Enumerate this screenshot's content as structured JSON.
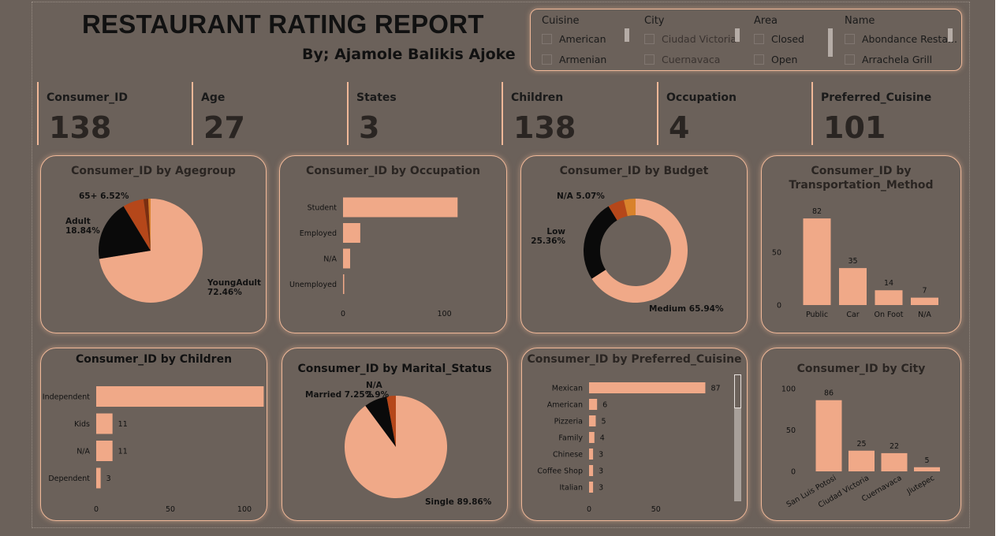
{
  "header": {
    "title": "RESTAURANT RATING REPORT",
    "subtitle": "By; Ajamole Balikis Ajoke"
  },
  "slicers": [
    {
      "label": "Cuisine",
      "items": [
        "American",
        "Armenian"
      ]
    },
    {
      "label": "City",
      "items": [
        "Ciudad Victoria",
        "Cuernavaca"
      ]
    },
    {
      "label": "Area",
      "items": [
        "Closed",
        "Open"
      ]
    },
    {
      "label": "Name",
      "items": [
        "Abondance Resta...",
        "Arrachela Grill"
      ]
    }
  ],
  "kpis": [
    {
      "label": "Consumer_ID",
      "value": "138"
    },
    {
      "label": "Age",
      "value": "27"
    },
    {
      "label": "States",
      "value": "3"
    },
    {
      "label": "Children",
      "value": "138"
    },
    {
      "label": "Occupation",
      "value": "4"
    },
    {
      "label": "Preferred_Cuisine",
      "value": "101"
    }
  ],
  "colors": {
    "background": "#6b615a",
    "accent": "#f0a988",
    "border": "#f0b898",
    "black": "#0a0a0a",
    "rust": "#b5471a",
    "orange": "#d9822b"
  },
  "chart_data": [
    {
      "id": "agegroup",
      "type": "pie",
      "title": "Consumer_ID by Agegroup",
      "slices": [
        {
          "name": "YoungAdult",
          "value": 72.46,
          "label": "YoungAdult\n72.46%"
        },
        {
          "name": "Adult",
          "value": 18.84,
          "label": "Adult\n18.84%"
        },
        {
          "name": "65+",
          "value": 6.52,
          "label": "65+ 6.52%"
        },
        {
          "name": "",
          "value": 1.45,
          "label": ""
        },
        {
          "name": "",
          "value": 0.73,
          "label": ""
        }
      ]
    },
    {
      "id": "occupation",
      "type": "bar",
      "orientation": "horizontal",
      "title": "Consumer_ID by Occupation",
      "categories": [
        "Student",
        "Employed",
        "N/A",
        "Unemployed"
      ],
      "values": [
        113,
        17,
        7,
        1
      ],
      "xticks": [
        0,
        100
      ],
      "xlim": [
        0,
        140
      ]
    },
    {
      "id": "budget",
      "type": "pie",
      "donut": true,
      "title": "Consumer_ID by Budget",
      "slices": [
        {
          "name": "Medium",
          "value": 65.94,
          "label": "Medium 65.94%"
        },
        {
          "name": "Low",
          "value": 25.36,
          "label": "Low\n25.36%"
        },
        {
          "name": "N/A",
          "value": 5.07,
          "label": "N/A 5.07%"
        },
        {
          "name": "",
          "value": 3.63,
          "label": ""
        }
      ]
    },
    {
      "id": "transport",
      "type": "bar",
      "orientation": "vertical",
      "title": "Consumer_ID by Transportation_Method",
      "title_lines": [
        "Consumer_ID by",
        "Transportation_Method"
      ],
      "categories": [
        "Public",
        "Car",
        "On Foot",
        "N/A"
      ],
      "values": [
        82,
        35,
        14,
        7
      ],
      "yticks": [
        0,
        50
      ],
      "ylim": [
        0,
        100
      ]
    },
    {
      "id": "children",
      "type": "bar",
      "orientation": "horizontal",
      "title": "Consumer_ID by Children",
      "categories": [
        "Independent",
        "Kids",
        "N/A",
        "Dependent"
      ],
      "values": [
        113,
        11,
        11,
        3
      ],
      "xticks": [
        0,
        50,
        100
      ],
      "xlim": [
        0,
        125
      ]
    },
    {
      "id": "marital",
      "type": "pie",
      "title": "Consumer_ID by Marital_Status",
      "slices": [
        {
          "name": "Single",
          "value": 89.86,
          "label": "Single 89.86%"
        },
        {
          "name": "Married",
          "value": 7.25,
          "label": "Married 7.25%"
        },
        {
          "name": "N/A",
          "value": 2.9,
          "label": "N/A\n2.9%"
        }
      ]
    },
    {
      "id": "cuisine",
      "type": "bar",
      "orientation": "horizontal",
      "title": "Consumer_ID by Preferred_Cuisine",
      "categories": [
        "Mexican",
        "American",
        "Pizzeria",
        "Family",
        "Chinese",
        "Coffee Shop",
        "Italian"
      ],
      "values": [
        87,
        6,
        5,
        4,
        3,
        3,
        3
      ],
      "xticks": [
        0,
        50
      ],
      "xlim": [
        0,
        95
      ]
    },
    {
      "id": "city",
      "type": "bar",
      "orientation": "vertical",
      "title": "Consumer_ID by City",
      "categories": [
        "San Luis Potosi",
        "Ciudad Victoria",
        "Cuernavaca",
        "Jiutepec"
      ],
      "values": [
        86,
        25,
        22,
        5
      ],
      "yticks": [
        0,
        50,
        100
      ],
      "ylim": [
        0,
        100
      ]
    }
  ]
}
